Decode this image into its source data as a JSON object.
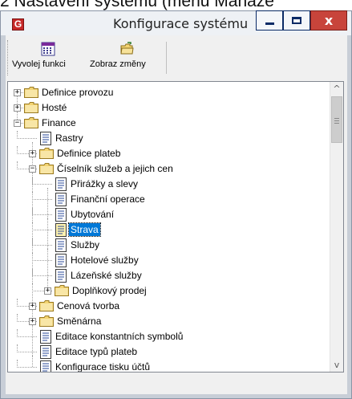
{
  "caption": "2 Nastavení systému (menu Manaže",
  "window": {
    "title": "Konfigurace systému",
    "close_label": "x",
    "app_icon_letter": "G"
  },
  "toolbar": {
    "buttons": [
      {
        "label": "Vyvolej funkci",
        "icon": "calendar-grid-icon"
      },
      {
        "label": "Zobraz změny",
        "icon": "folder-arrow-icon"
      }
    ]
  },
  "tree": {
    "nodes": [
      {
        "label": "Definice provozu",
        "level": 0,
        "type": "folder",
        "expander": "+"
      },
      {
        "label": "Hosté",
        "level": 0,
        "type": "folder",
        "expander": "+"
      },
      {
        "label": "Finance",
        "level": 0,
        "type": "folder",
        "expander": "-"
      },
      {
        "label": "Rastry",
        "level": 1,
        "type": "document",
        "expander": ""
      },
      {
        "label": "Definice plateb",
        "level": 1,
        "type": "folder",
        "expander": "+"
      },
      {
        "label": "Číselník služeb a jejich cen",
        "level": 1,
        "type": "folder",
        "expander": "-"
      },
      {
        "label": "Přirážky a slevy",
        "level": 2,
        "type": "document",
        "expander": ""
      },
      {
        "label": "Finanční operace",
        "level": 2,
        "type": "document",
        "expander": ""
      },
      {
        "label": "Ubytování",
        "level": 2,
        "type": "document",
        "expander": ""
      },
      {
        "label": "Strava",
        "level": 2,
        "type": "document",
        "expander": "",
        "selected": true
      },
      {
        "label": "Služby",
        "level": 2,
        "type": "document",
        "expander": ""
      },
      {
        "label": "Hotelové služby",
        "level": 2,
        "type": "document",
        "expander": ""
      },
      {
        "label": "Lázeňské služby",
        "level": 2,
        "type": "document",
        "expander": ""
      },
      {
        "label": "Doplňkový prodej",
        "level": 2,
        "type": "folder",
        "expander": "+"
      },
      {
        "label": "Cenová tvorba",
        "level": 1,
        "type": "folder",
        "expander": "+"
      },
      {
        "label": "Směnárna",
        "level": 1,
        "type": "folder",
        "expander": "+"
      },
      {
        "label": "Editace konstantních symbolů",
        "level": 1,
        "type": "document",
        "expander": ""
      },
      {
        "label": "Editace typů plateb",
        "level": 1,
        "type": "document",
        "expander": ""
      },
      {
        "label": "Konfigurace tisku účtů",
        "level": 1,
        "type": "document",
        "expander": ""
      }
    ]
  },
  "colors": {
    "selection": "#0078d7",
    "folder_fill": "#f3d473",
    "close_button": "#c8443b"
  }
}
